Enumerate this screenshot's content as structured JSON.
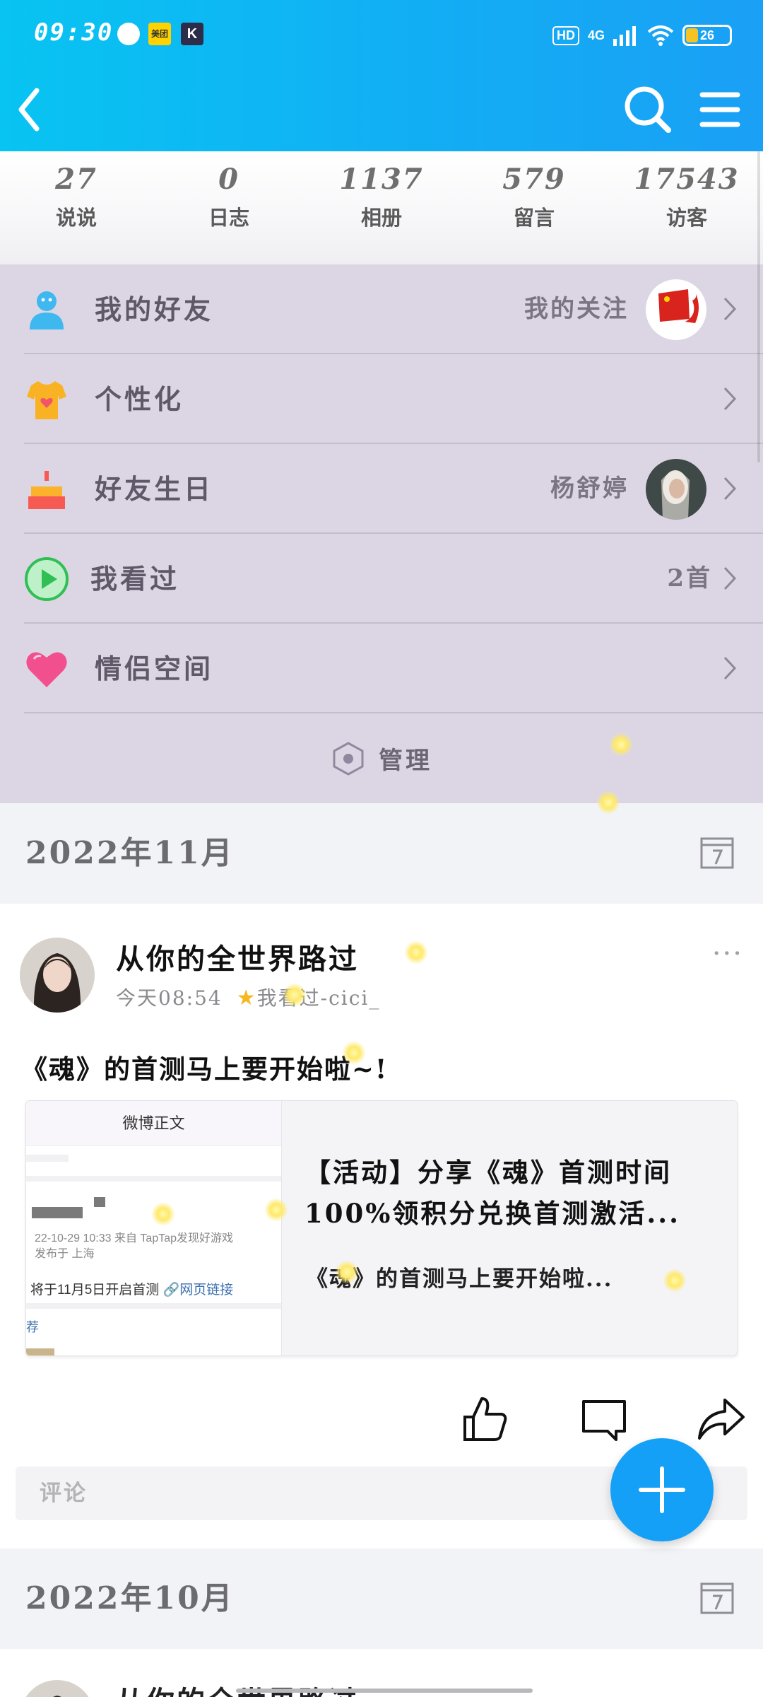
{
  "status_bar": {
    "time": "09:30",
    "app_icon_1": "美团",
    "app_icon_2": "K",
    "hd": "HD",
    "network": "4G",
    "battery": "26",
    "battery_level": 0.26
  },
  "navbar": {
    "back_icon": "chevron-left-icon",
    "search_icon": "search-icon",
    "menu_icon": "hamburger-icon"
  },
  "stats": [
    {
      "count": "27",
      "label": "说说"
    },
    {
      "count": "0",
      "label": "日志"
    },
    {
      "count": "1137",
      "label": "相册"
    },
    {
      "count": "579",
      "label": "留言"
    },
    {
      "count": "17543",
      "label": "访客"
    }
  ],
  "menu": {
    "friends": {
      "label": "我的好友",
      "right": "我的关注"
    },
    "personalize": {
      "label": "个性化"
    },
    "birthday": {
      "label": "好友生日",
      "right": "杨舒婷"
    },
    "watched": {
      "label": "我看过",
      "right": "2首"
    },
    "couple": {
      "label": "情侣空间"
    },
    "manage_label": "管理"
  },
  "sections": {
    "nov": "2022年11月",
    "oct": "2022年10月"
  },
  "post": {
    "author": "从你的全世界路过",
    "time": "今天08:54",
    "source": "我看过-cici_",
    "more": "···",
    "text": "《魂》的首测马上要开始啦~!",
    "link_card": {
      "thumb_title": "微博正文",
      "thumb_meta_1": "22-10-29 10:33  来自 TapTap发现好游戏",
      "thumb_meta_2": "发布于 上海",
      "thumb_body": "将于11月5日开启首测",
      "thumb_link": "🔗网页链接",
      "thumb_rec": "荐",
      "title": "【活动】分享《魂》首测时间100%领积分兑换首测激活...",
      "desc": "《魂》的首测马上要开始啦..."
    },
    "comment_placeholder": "评论"
  },
  "post2": {
    "author": "从你的全世界路过"
  },
  "colors": {
    "header_start": "#08c4f2",
    "header_end": "#1aa0f5",
    "menu_bg": "#dcd6e4",
    "fab": "#15a0f7"
  }
}
